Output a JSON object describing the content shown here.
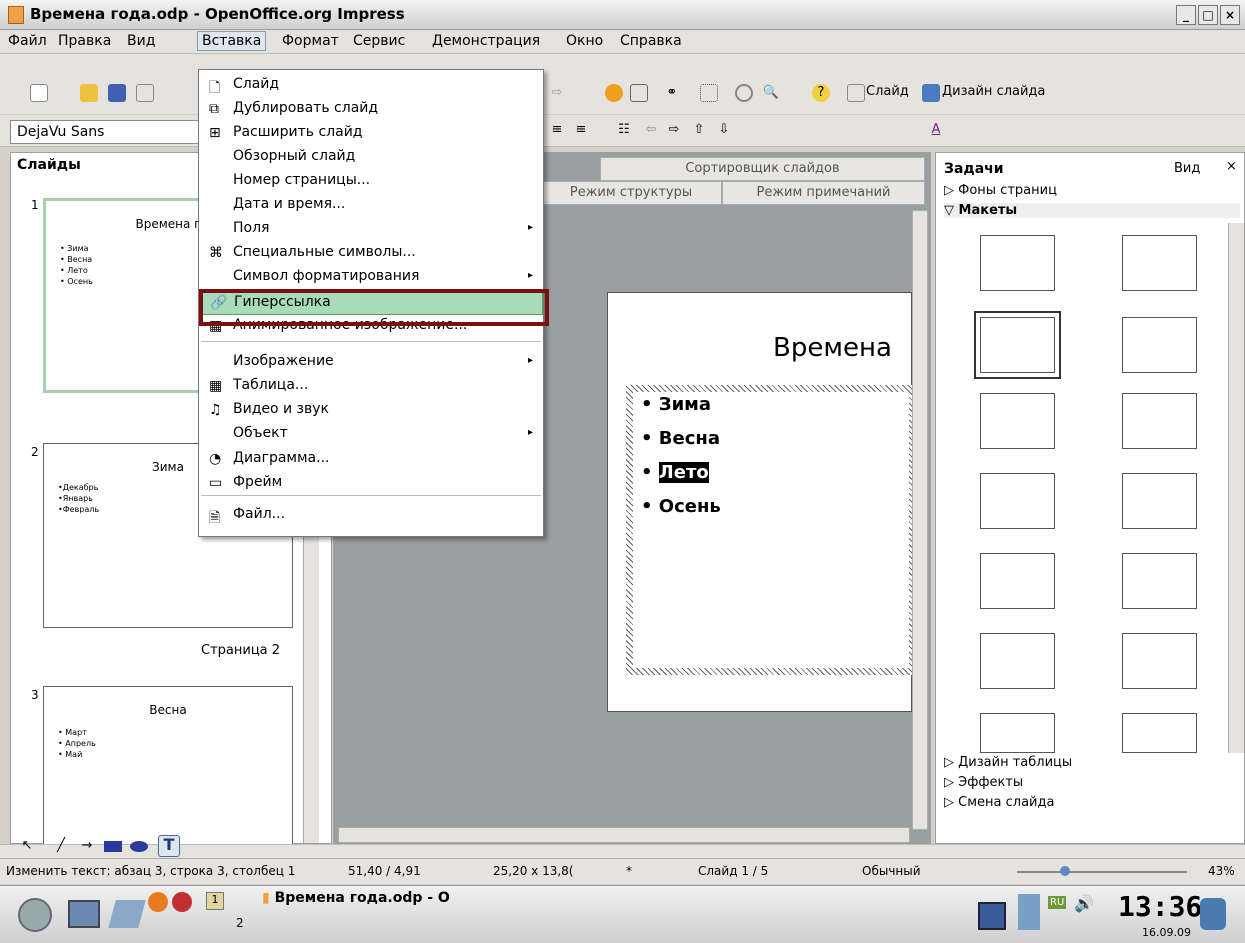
{
  "window": {
    "title": "Времена года.odp - OpenOffice.org Impress",
    "min": "_",
    "max": "□",
    "close": "×"
  },
  "menubar": [
    "Файл",
    "Правка",
    "Вид",
    "Вставка",
    "Формат",
    "Сервис",
    "Демонстрация",
    "Окно",
    "Справка"
  ],
  "toolbar": {
    "slide_label": "Слайд",
    "design_label": "Дизайн слайда",
    "font": "DejaVu Sans"
  },
  "slides_panel": {
    "title": "Слайды",
    "page_caption": "Страница 2",
    "slides": [
      {
        "num": "1",
        "title": "Времена г",
        "items": "• Зима\n• Весна\n• Лето\n• Осень"
      },
      {
        "num": "2",
        "title": "Зима",
        "items": "•Декабрь\n•Январь\n•Февраль"
      },
      {
        "num": "3",
        "title": "Весна",
        "items": "• Март\n• Апрель\n• Май"
      }
    ]
  },
  "tabs": {
    "sorter": "Сортировщик слайдов",
    "outline": "Режим структуры",
    "notes": "Режим примечаний"
  },
  "slide": {
    "title": "Времена",
    "bullets": [
      "Зима",
      "Весна",
      "Лето",
      "Осень"
    ]
  },
  "tasks": {
    "title": "Задачи",
    "view": "Вид",
    "backgrounds": "Фоны страниц",
    "layouts": "Макеты",
    "table_design": "Дизайн таблицы",
    "effects": "Эффекты",
    "transition": "Смена слайда"
  },
  "insert_menu": {
    "items": [
      {
        "label": "Слайд",
        "icon": "🗋"
      },
      {
        "label": "Дублировать слайд",
        "icon": "⧉"
      },
      {
        "label": "Расширить слайд",
        "icon": "⊞"
      },
      {
        "label": "Обзорный слайд",
        "icon": ""
      },
      {
        "label": "Номер страницы...",
        "icon": ""
      },
      {
        "label": "Дата и время...",
        "icon": ""
      },
      {
        "label": "Поля",
        "icon": "",
        "sub": true
      },
      {
        "label": "Специальные символы...",
        "icon": "⌘"
      },
      {
        "label": "Символ форматирования",
        "icon": "",
        "sub": true
      },
      {
        "label": "Гиперссылка",
        "icon": "🔗"
      },
      {
        "label": "Анимированное изображение...",
        "icon": "▦"
      },
      {
        "label": "Изображение",
        "icon": "",
        "sub": true
      },
      {
        "label": "Таблица...",
        "icon": "▦"
      },
      {
        "label": "Видео и звук",
        "icon": "♫"
      },
      {
        "label": "Объект",
        "icon": "",
        "sub": true
      },
      {
        "label": "Диаграмма...",
        "icon": "◔"
      },
      {
        "label": "Фрейм",
        "icon": "▭"
      },
      {
        "label": "Файл...",
        "icon": "🗎"
      }
    ]
  },
  "status": {
    "text": "Изменить текст: абзац 3, строка 3, столбец 1",
    "pos": "51,40 / 4,91",
    "size": "25,20 x 13,8(",
    "mod": "*",
    "slide": "Слайд 1 / 5",
    "layout": "Обычный",
    "zoom": "43%"
  },
  "taskbar": {
    "app": "Времена года.odp - O",
    "lang": "RU",
    "clock": "13:36",
    "date": "16.09.09",
    "desk1": "1",
    "desk2": "2"
  }
}
